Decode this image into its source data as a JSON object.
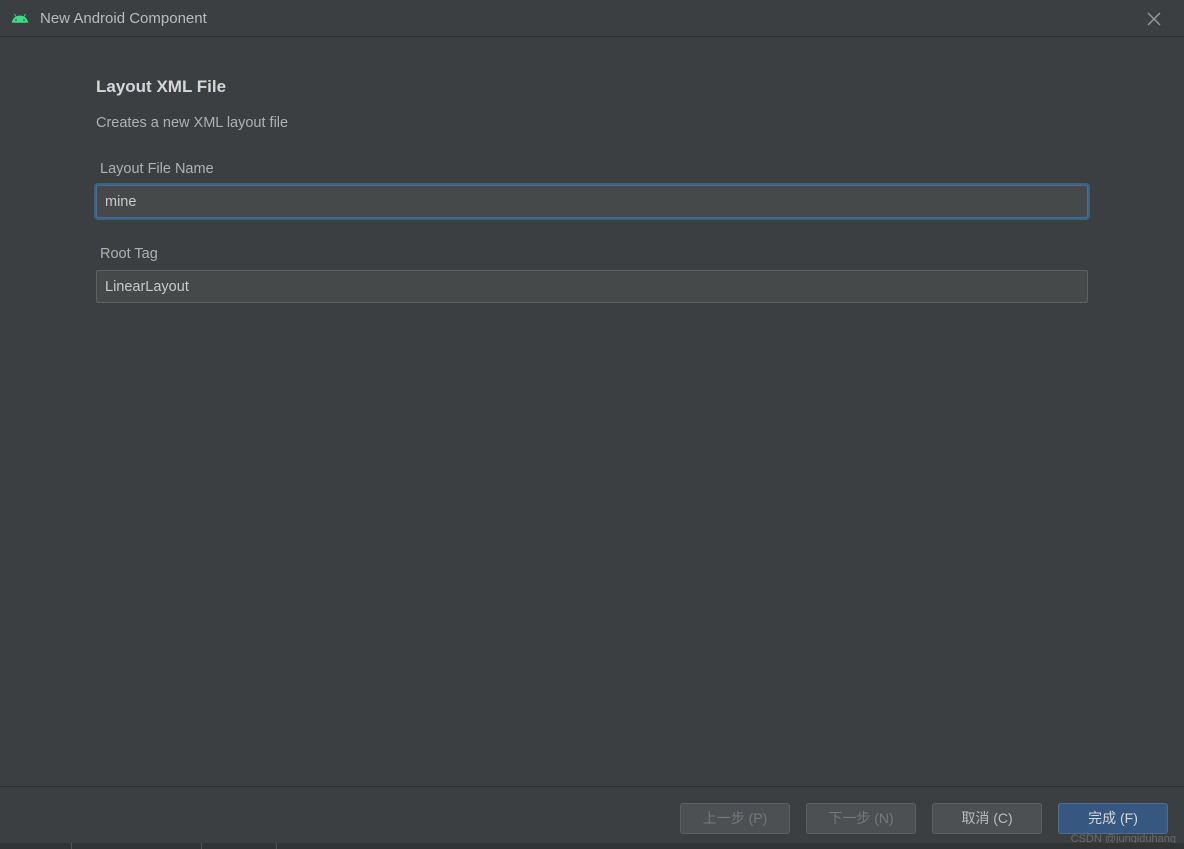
{
  "window": {
    "title": "New Android Component"
  },
  "page": {
    "heading": "Layout XML File",
    "description": "Creates a new XML layout file"
  },
  "fields": {
    "layout_file_name": {
      "label": "Layout File Name",
      "value": "mine"
    },
    "root_tag": {
      "label": "Root Tag",
      "value": "LinearLayout"
    }
  },
  "buttons": {
    "previous": "上一步 (P)",
    "next": "下一步 (N)",
    "cancel": "取消 (C)",
    "finish": "完成 (F)"
  },
  "watermark": "CSDN @junqiduhang"
}
